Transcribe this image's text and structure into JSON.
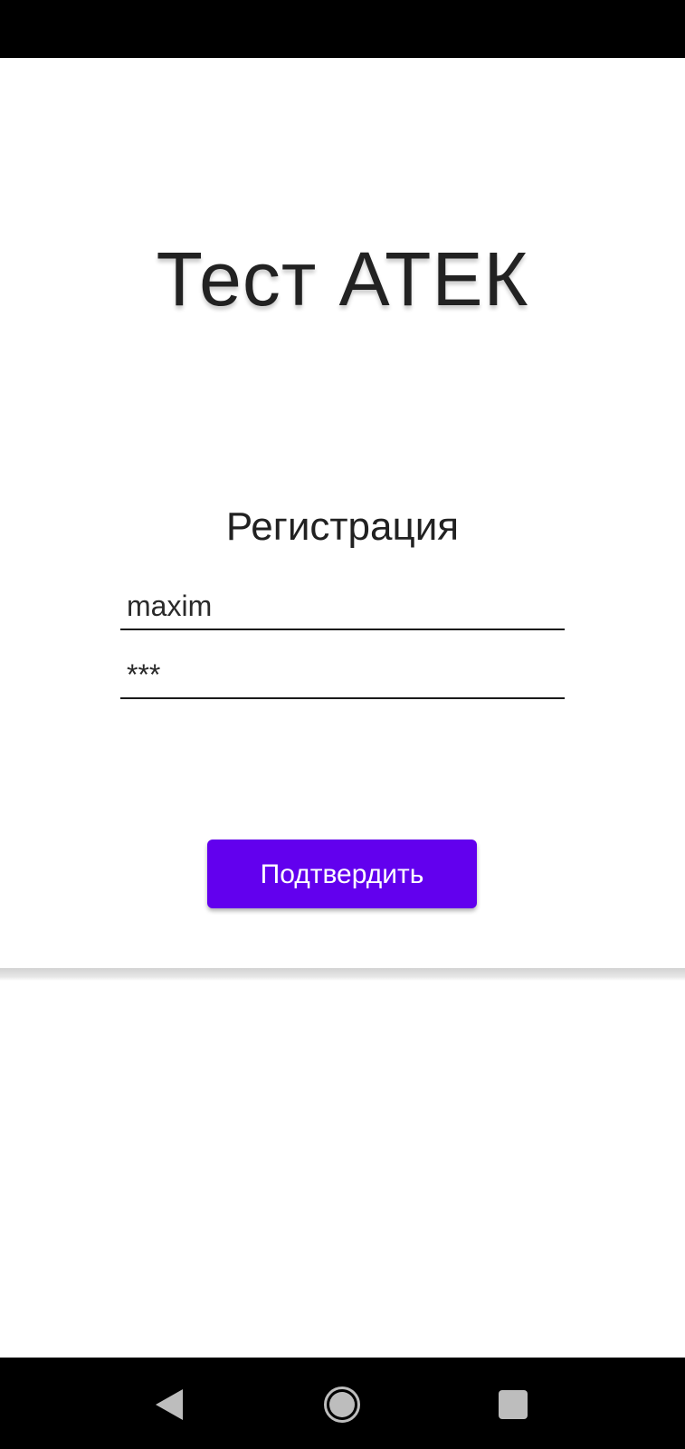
{
  "app": {
    "title": "Тест АТЕК"
  },
  "form": {
    "heading": "Регистрация",
    "login_value": "maxim",
    "password_value": "***",
    "submit_label": "Подтвердить"
  },
  "nav": {
    "back_icon": "back-triangle-icon",
    "home_icon": "home-circle-icon",
    "recents_icon": "recents-square-icon"
  },
  "colors": {
    "accent": "#6200ee",
    "status_bar": "#000000",
    "nav_bar": "#000000"
  }
}
